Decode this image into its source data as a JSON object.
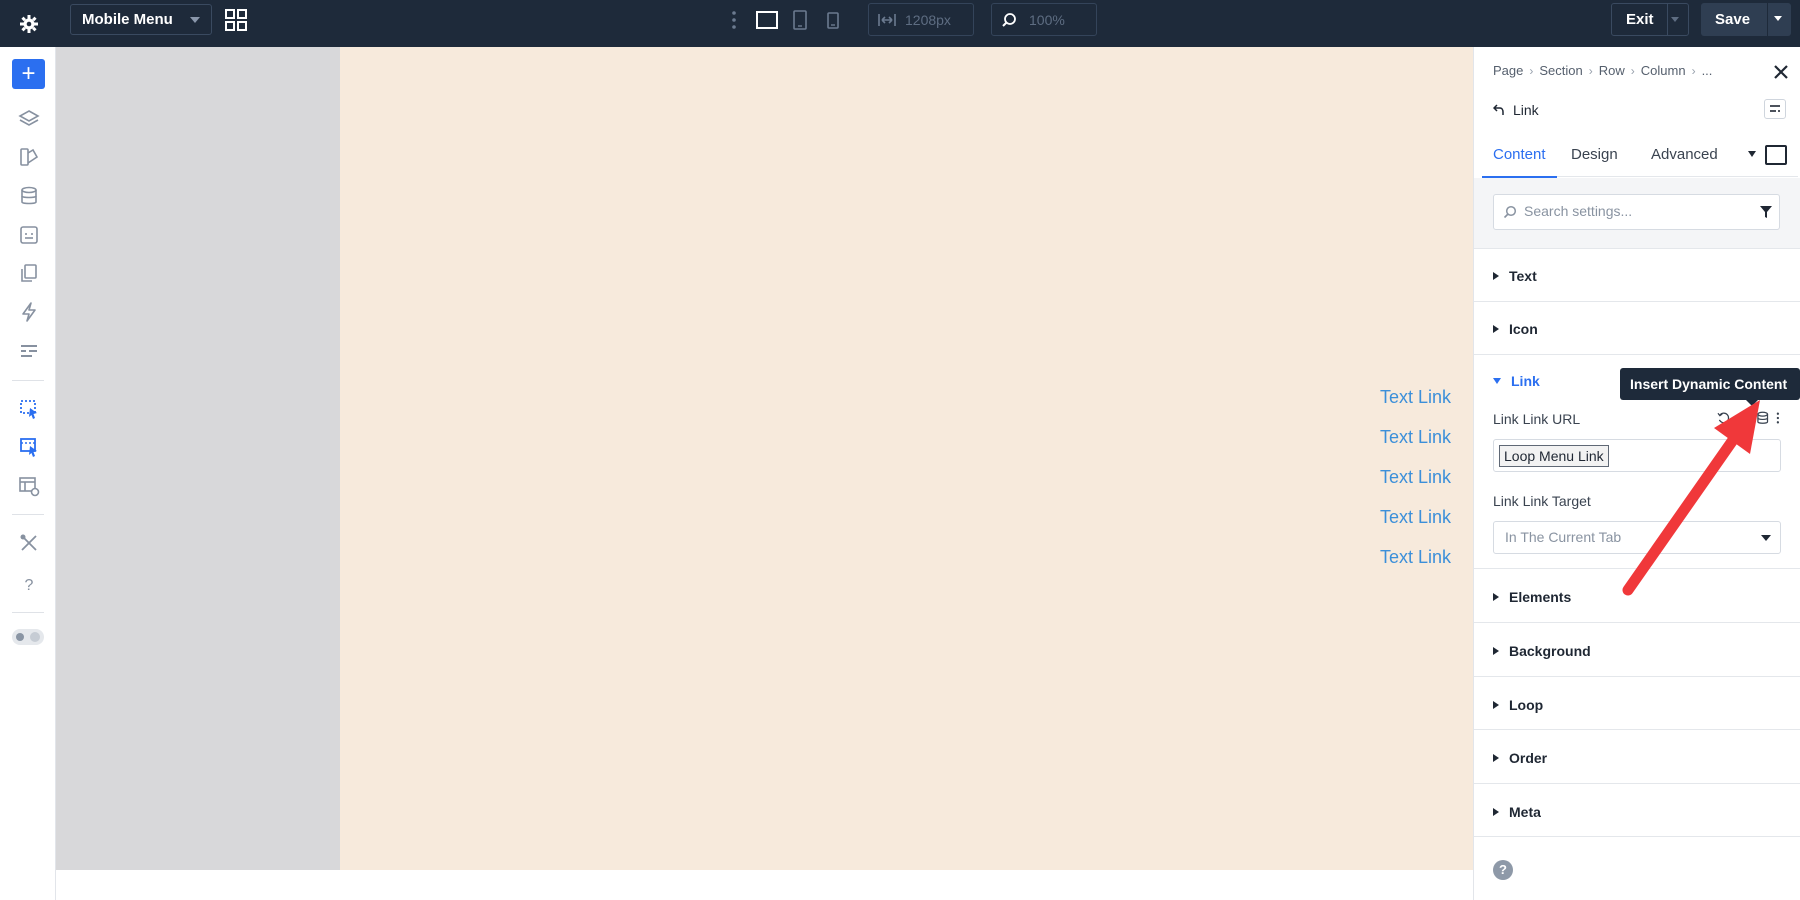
{
  "topbar": {
    "menu_select_value": "Mobile Menu",
    "width_field": "1208px",
    "zoom_field": "100%",
    "exit_label": "Exit",
    "save_label": "Save"
  },
  "canvas": {
    "links": [
      "Text Link",
      "Text Link",
      "Text Link",
      "Text Link",
      "Text Link"
    ]
  },
  "panel": {
    "breadcrumb": [
      "Page",
      "Section",
      "Row",
      "Column",
      "..."
    ],
    "title": "Link",
    "tabs": [
      "Content",
      "Design",
      "Advanced"
    ],
    "search_placeholder": "Search settings...",
    "sections": {
      "text": "Text",
      "icon": "Icon",
      "link": "Link",
      "elements": "Elements",
      "background": "Background",
      "loop": "Loop",
      "order": "Order",
      "meta": "Meta"
    },
    "link_url_label": "Link Link URL",
    "link_url_value": "Loop Menu Link",
    "link_target_label": "Link Link Target",
    "link_target_value": "In The Current Tab",
    "help_label": "?"
  },
  "tooltip": "Insert Dynamic Content",
  "colors": {
    "accent": "#2b6ff0",
    "topbar": "#1e2a3a",
    "link": "#3b8fd9",
    "arrow": "#f0383a"
  }
}
